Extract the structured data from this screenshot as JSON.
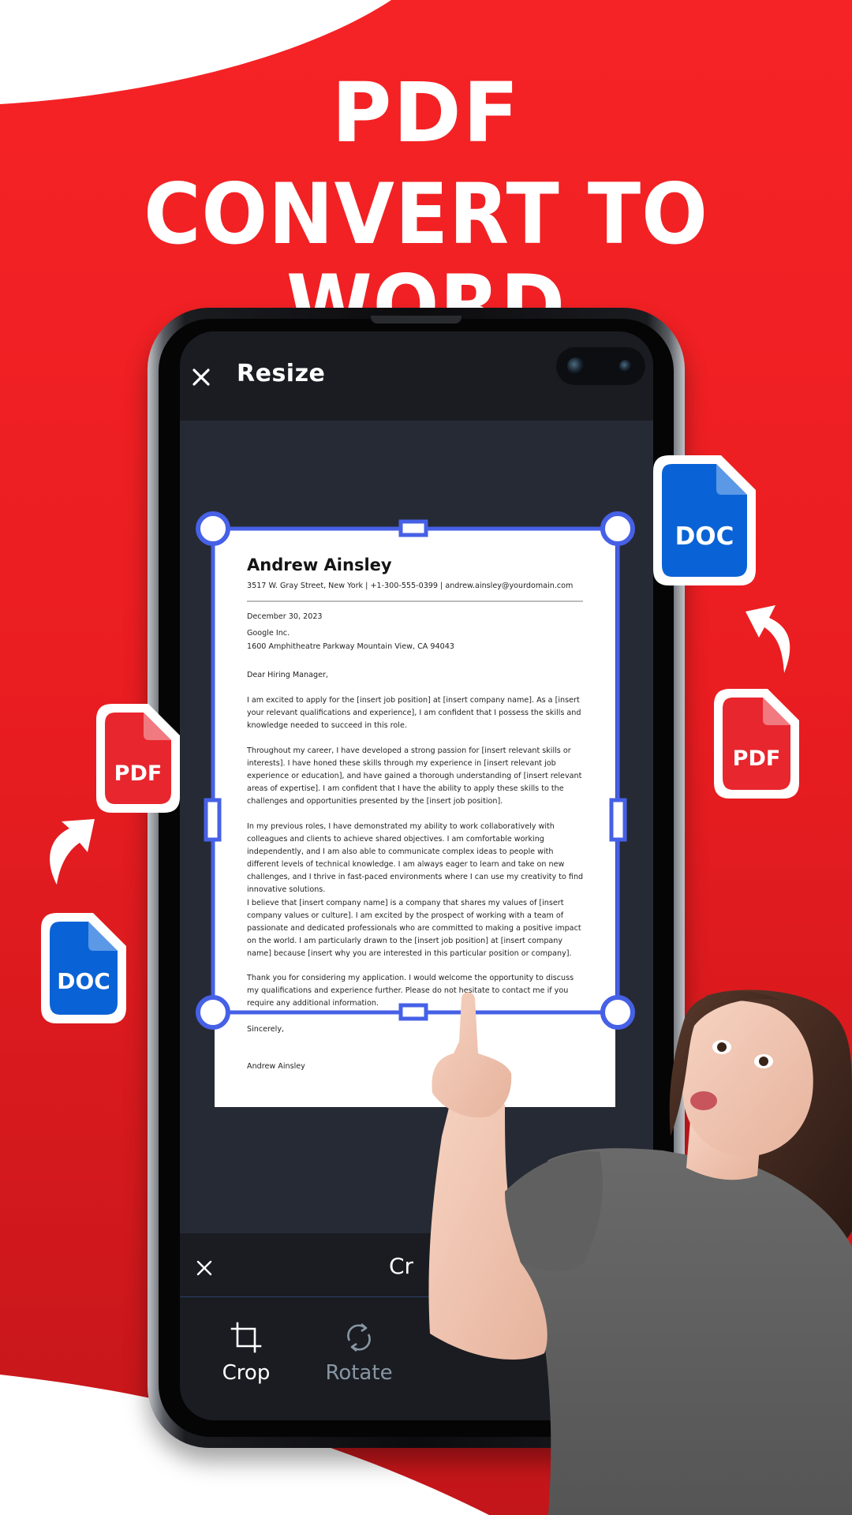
{
  "promo": {
    "headline_line1": "PDF",
    "headline_line2": "CONVERT TO WORD"
  },
  "colors": {
    "background_red": "#f52225",
    "crop_accent": "#4660e6",
    "doc_blue": "#0a63d6",
    "pdf_red": "#e8262e",
    "screen_dark": "#262a34",
    "bar_dark": "#1a1c22",
    "rotate_inactive": "#8796a2"
  },
  "app": {
    "header": {
      "close_icon": "close-icon",
      "title": "Resize"
    },
    "bottom_sheet": {
      "close_icon": "close-icon",
      "title_visible": "Cr",
      "tools": [
        {
          "label": "Crop",
          "icon": "crop-icon",
          "active": true
        },
        {
          "label": "Rotate",
          "icon": "rotate-icon",
          "active": false
        }
      ]
    }
  },
  "document": {
    "name": "Andrew Ainsley",
    "contact": "3517 W. Gray Street, New York | +1-300-555-0399 | andrew.ainsley@yourdomain.com",
    "date": "December 30, 2023",
    "company": "Google Inc.",
    "company_address": "1600 Amphitheatre Parkway Mountain View, CA 94043",
    "salutation": "Dear Hiring Manager,",
    "paragraphs": [
      "I am excited to apply for the [insert job position] at [insert company name]. As a [insert your relevant qualifications and experience], I am confident that I possess the skills and knowledge needed to succeed in this role.",
      "Throughout my career, I have developed a strong passion for [insert relevant skills or interests]. I have honed these skills through my experience in [insert relevant job experience or education], and have gained a thorough understanding of [insert relevant areas of expertise]. I am confident that I have the ability to apply these skills to the challenges and opportunities presented by the [insert job position].",
      "In my previous roles, I have demonstrated my ability to work collaboratively with colleagues and clients to achieve shared objectives. I am comfortable working independently, and I am also able to communicate complex ideas to people with different levels of technical knowledge. I am always eager to learn and take on new challenges, and I thrive in fast-paced environments where I can use my creativity to find innovative solutions.",
      "I believe that [insert company name] is a company that shares my values of [insert company values or culture]. I am excited by the prospect of working with a team of passionate and dedicated professionals who are committed to making a positive impact on the world. I am particularly drawn to the [insert job position] at [insert company name] because [insert why you are interested in this particular position or company].",
      "Thank you for considering my application. I would welcome the opportunity to discuss my qualifications and experience further. Please do not hesitate to contact me if you require any additional information."
    ],
    "closing": "Sincerely,",
    "signature": "Andrew Ainsley"
  },
  "badges": {
    "doc_label": "DOC",
    "pdf_label": "PDF"
  }
}
